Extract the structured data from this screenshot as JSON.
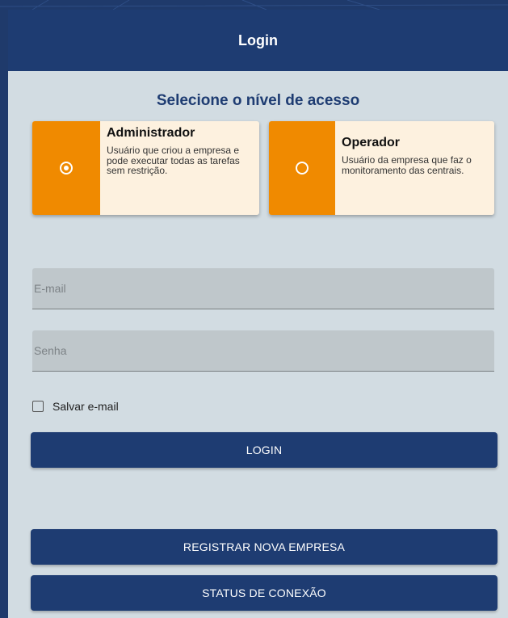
{
  "header": {
    "title": "Login"
  },
  "access": {
    "title": "Selecione o nível de acesso",
    "options": [
      {
        "title": "Administrador",
        "description": "Usuário que criou a empresa e pode executar todas as tarefas sem restrição.",
        "selected": true
      },
      {
        "title": "Operador",
        "description": "Usuário da empresa que faz o monitoramento das centrais.",
        "selected": false
      }
    ]
  },
  "form": {
    "email_placeholder": "E-mail",
    "password_placeholder": "Senha",
    "save_email_label": "Salvar e-mail",
    "login_label": "LOGIN"
  },
  "footer": {
    "register_label": "REGISTRAR NOVA EMPRESA",
    "status_label": "STATUS DE CONEXÃO"
  },
  "colors": {
    "primary": "#1e3c72",
    "accent": "#f08a00",
    "card_background": "#fdf1df",
    "panel_background": "#d2dce2"
  }
}
